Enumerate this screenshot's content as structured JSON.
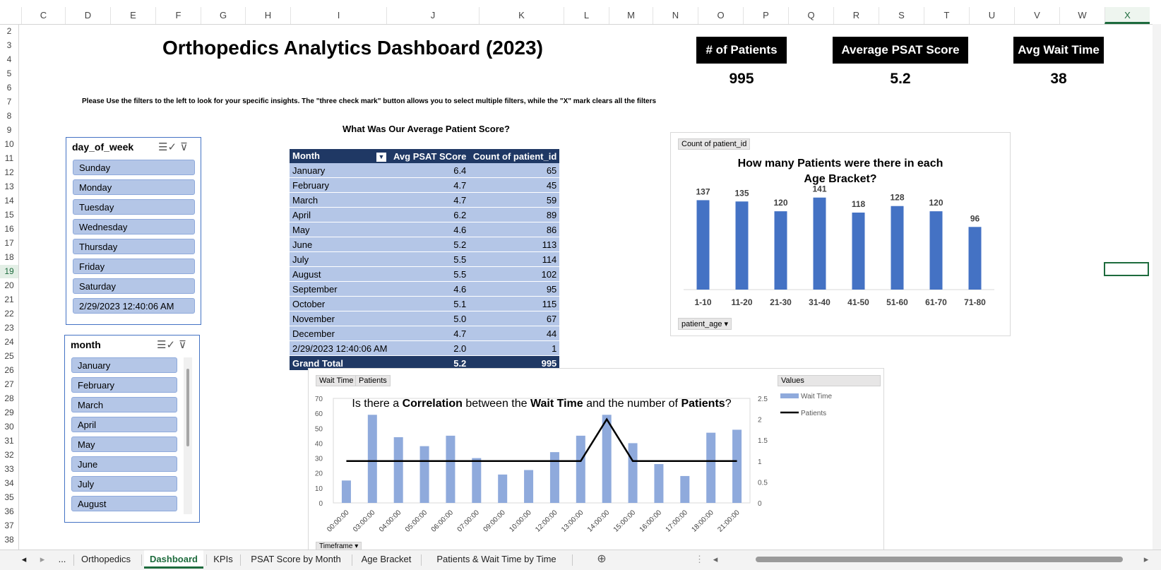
{
  "columns": [
    "C",
    "D",
    "E",
    "F",
    "G",
    "H",
    "I",
    "J",
    "K",
    "L",
    "M",
    "N",
    "O",
    "P",
    "Q",
    "R",
    "S",
    "T",
    "U",
    "V",
    "W",
    "X"
  ],
  "selected_column": "X",
  "rows": [
    "2",
    "3",
    "4",
    "5",
    "6",
    "7",
    "8",
    "9",
    "10",
    "11",
    "12",
    "13",
    "14",
    "15",
    "16",
    "17",
    "18",
    "19",
    "20",
    "21",
    "22",
    "23",
    "24",
    "25",
    "26",
    "27",
    "28",
    "29",
    "30",
    "31",
    "32",
    "33",
    "34",
    "35",
    "36",
    "37",
    "38"
  ],
  "selected_row": "19",
  "title": "Orthopedics Analytics Dashboard (2023)",
  "instructions": "Please Use the filters to the left to look for your specific insights. The \"three check mark\" button allows you to select multiple filters, while the \"X\" mark clears  all the filters",
  "kpis": {
    "patients_label": "# of Patients",
    "patients_value": "995",
    "psat_label": "Average PSAT Score",
    "psat_value": "5.2",
    "wait_label": "Avg Wait Time",
    "wait_value": "38"
  },
  "slicer_day": {
    "title": "day_of_week",
    "items": [
      "Sunday",
      "Monday",
      "Tuesday",
      "Wednesday",
      "Thursday",
      "Friday",
      "Saturday",
      "2/29/2023  12:40:06 AM"
    ]
  },
  "slicer_month": {
    "title": "month",
    "items": [
      "January",
      "February",
      "March",
      "April",
      "May",
      "June",
      "July",
      "August"
    ]
  },
  "icons": {
    "multiselect": "multi-select-icon",
    "clear": "clear-filter-icon"
  },
  "pivot": {
    "heading": "What Was Our Average Patient Score?",
    "headers": [
      "Month",
      "Avg PSAT SCore",
      "Count of patient_id"
    ],
    "rows": [
      [
        "January",
        "6.4",
        "65"
      ],
      [
        "February",
        "4.7",
        "45"
      ],
      [
        "March",
        "4.7",
        "59"
      ],
      [
        "April",
        "6.2",
        "89"
      ],
      [
        "May",
        "4.6",
        "86"
      ],
      [
        "June",
        "5.2",
        "113"
      ],
      [
        "July",
        "5.5",
        "114"
      ],
      [
        "August",
        "5.5",
        "102"
      ],
      [
        "September",
        "4.6",
        "95"
      ],
      [
        "October",
        "5.1",
        "115"
      ],
      [
        "November",
        "5.0",
        "67"
      ],
      [
        "December",
        "4.7",
        "44"
      ],
      [
        "2/29/2023  12:40:06 AM",
        "2.0",
        "1"
      ]
    ],
    "total": [
      "Grand Total",
      "5.2",
      "995"
    ]
  },
  "age_chart_ui": {
    "field_button": "Count of patient_id",
    "axis_button": "patient_age"
  },
  "wait_chart_ui": {
    "field_wait": "Wait Time",
    "field_patients": "Patients",
    "values_label": "Values",
    "timeframe": "Timeframe",
    "title_parts": [
      "Is there a ",
      "Correlation",
      " between the ",
      "Wait Time",
      " and the number of ",
      "Patients",
      "?"
    ]
  },
  "tabs": [
    "Orthopedics",
    "Dashboard",
    "KPIs",
    "PSAT Score by Month",
    "Age Bracket",
    "Patients & Wait Time by Time"
  ],
  "active_tab": "Dashboard",
  "tab_more": "...",
  "colors": {
    "bar": "#4472c4",
    "bar_light": "#8faadc",
    "header_dark": "#1f3864",
    "excel_green": "#1d6b3d"
  },
  "chart_data": [
    {
      "type": "bar",
      "title": "How many Patients were there in each Age Bracket?",
      "categories": [
        "1-10",
        "11-20",
        "21-30",
        "31-40",
        "41-50",
        "51-60",
        "61-70",
        "71-80"
      ],
      "values": [
        137,
        135,
        120,
        141,
        118,
        128,
        120,
        96
      ],
      "ylim": [
        0,
        150
      ],
      "grid": false,
      "legend": "none"
    },
    {
      "type": "bar",
      "title": "Is there a Correlation between the Wait Time and the number of Patients?",
      "categories": [
        "00:00:00",
        "03:00:00",
        "04:00:00",
        "05:00:00",
        "06:00:00",
        "07:00:00",
        "09:00:00",
        "10:00:00",
        "12:00:00",
        "13:00:00",
        "14:00:00",
        "15:00:00",
        "16:00:00",
        "17:00:00",
        "18:00:00",
        "21:00:00"
      ],
      "series": [
        {
          "name": "Wait Time",
          "type": "bar",
          "axis": "left",
          "values": [
            15,
            59,
            44,
            38,
            45,
            30,
            19,
            22,
            34,
            45,
            59,
            40,
            26,
            18,
            47,
            49
          ]
        },
        {
          "name": "Patients",
          "type": "line",
          "axis": "right",
          "values": [
            1,
            1,
            1,
            1,
            1,
            1,
            1,
            1,
            1,
            1,
            2,
            1,
            1,
            1,
            1,
            1
          ]
        }
      ],
      "yticks_left": [
        "0",
        "10",
        "20",
        "30",
        "40",
        "50",
        "60",
        "70"
      ],
      "yticks_right": [
        "0",
        "0.5",
        "1",
        "1.5",
        "2",
        "2.5"
      ],
      "ylim_left": [
        0,
        70
      ],
      "ylim_right": [
        0,
        2.5
      ],
      "legend": "right"
    }
  ]
}
